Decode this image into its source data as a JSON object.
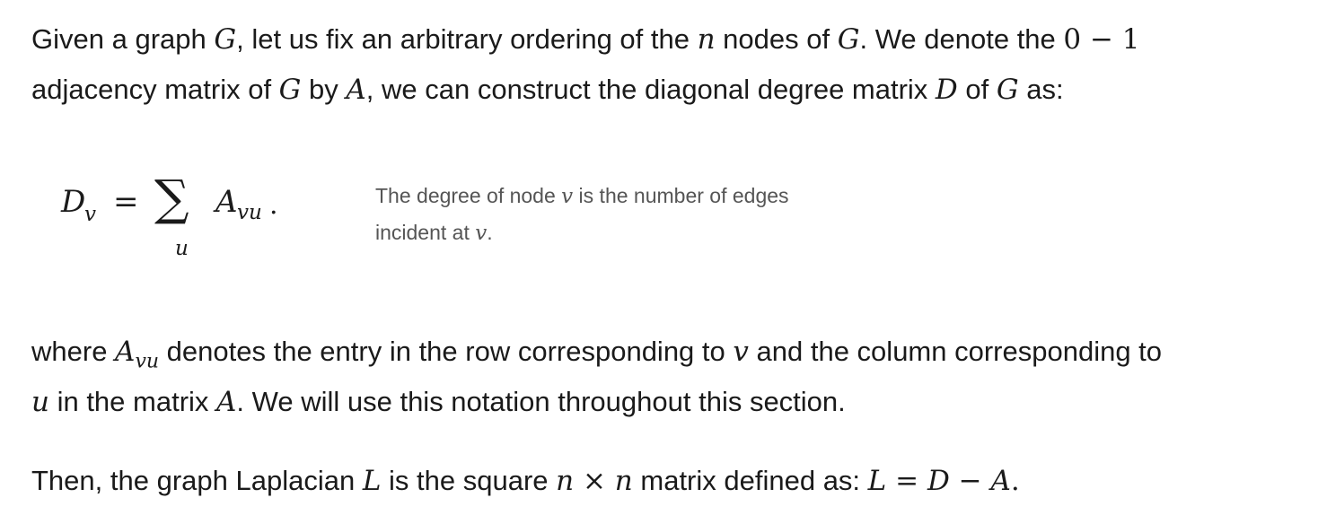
{
  "para1": {
    "line1": {
      "t1": "Given a graph ",
      "G1": "G",
      "t2": ", let us fix an arbitrary ordering of the ",
      "n": "n",
      "t3": " nodes of ",
      "G2": "G",
      "t4": ". We denote the ",
      "zero_one": "0 − 1"
    },
    "line2": {
      "t1": "adjacency matrix of ",
      "G": "G",
      "t2": " by ",
      "A": "A",
      "t3": ", we can construct the diagonal degree matrix ",
      "D": "D",
      "t4": " of ",
      "G2": "G",
      "t5": " as:"
    }
  },
  "equation": {
    "lhs": "D",
    "lhs_sub": "v",
    "equals": "=",
    "sum": "∑",
    "sum_index": "u",
    "term": "A",
    "term_sub": "vu",
    "period": "."
  },
  "sidenote": {
    "t1": "The degree of node ",
    "v1": "v",
    "t2": " is the number of edges",
    "t3": "incident at ",
    "v2": "v",
    "t4": "."
  },
  "para2": {
    "line1": {
      "t1": "where ",
      "A": "A",
      "sub": "vu",
      "t2": " denotes the entry in the row corresponding to ",
      "v": "v",
      "t3": " and the column corresponding to"
    },
    "line2": {
      "u": "u",
      "t1": " in the matrix ",
      "A": "A",
      "t2": ". We will use this notation throughout this section."
    }
  },
  "para3": {
    "t1": "Then, the graph Laplacian ",
    "L": "L",
    "t2": " is the square ",
    "n1": "n",
    "times": " × ",
    "n2": "n",
    "t3": " matrix defined as: ",
    "L2": "L",
    "eq": " = ",
    "D": "D",
    "minus": " − ",
    "A": "A",
    "t4": "."
  }
}
